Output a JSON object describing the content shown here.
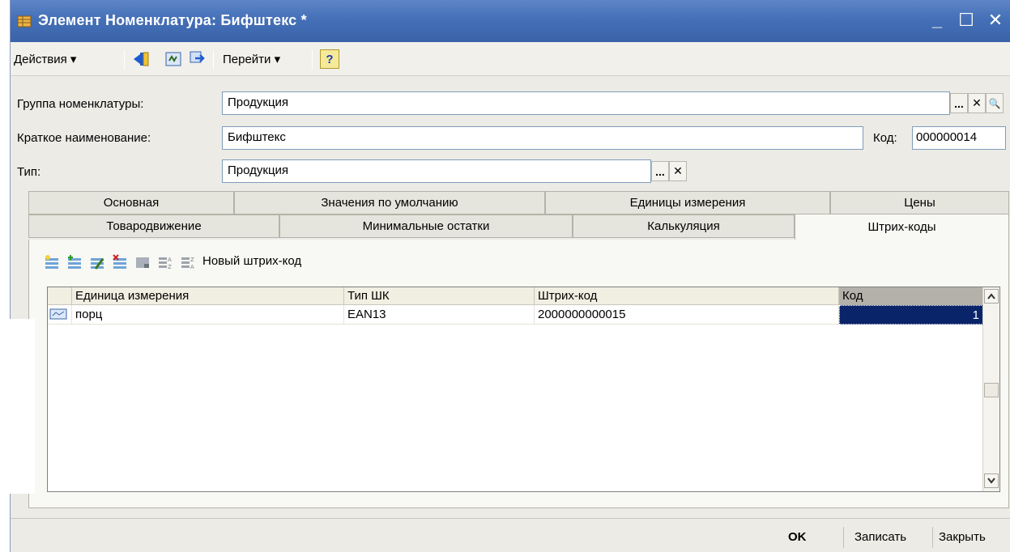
{
  "window": {
    "title": "Элемент Номенклатура: Бифштекс *",
    "controls": {
      "minimize": "_",
      "maximize": "☐",
      "close": "✕"
    }
  },
  "toolbar": {
    "actions_label": "Действия ▾",
    "goto_label": "Перейти ▾",
    "help_label": "?"
  },
  "form": {
    "group_label": "Группа номенклатуры:",
    "group_value": "Продукция",
    "short_name_label": "Краткое наименование:",
    "short_name_value": "Бифштекс",
    "code_label": "Код:",
    "code_value": "000000014",
    "type_label": "Тип:",
    "type_value": "Продукция",
    "select_button": "...",
    "clear_button": "✕",
    "open_button": "🔍"
  },
  "tabs": {
    "row1": [
      "Основная",
      "Значения по умолчанию",
      "Единицы измерения",
      "Цены"
    ],
    "row2": [
      "Товародвижение",
      "Минимальные остатки",
      "Калькуляция",
      "Штрих-коды"
    ],
    "active": "Штрих-коды"
  },
  "barcodes": {
    "new_barcode_label": "Новый штрих-код",
    "columns": [
      "Единица измерения",
      "Тип ШК",
      "Штрих-код",
      "Код"
    ],
    "rows": [
      {
        "unit": "порц",
        "type": "EAN13",
        "barcode": "2000000000015",
        "code": "1"
      }
    ]
  },
  "footer": {
    "ok": "OK",
    "save": "Записать",
    "close": "Закрыть"
  },
  "colors": {
    "title_bar": "#4570b7",
    "selection": "#0a246a"
  }
}
